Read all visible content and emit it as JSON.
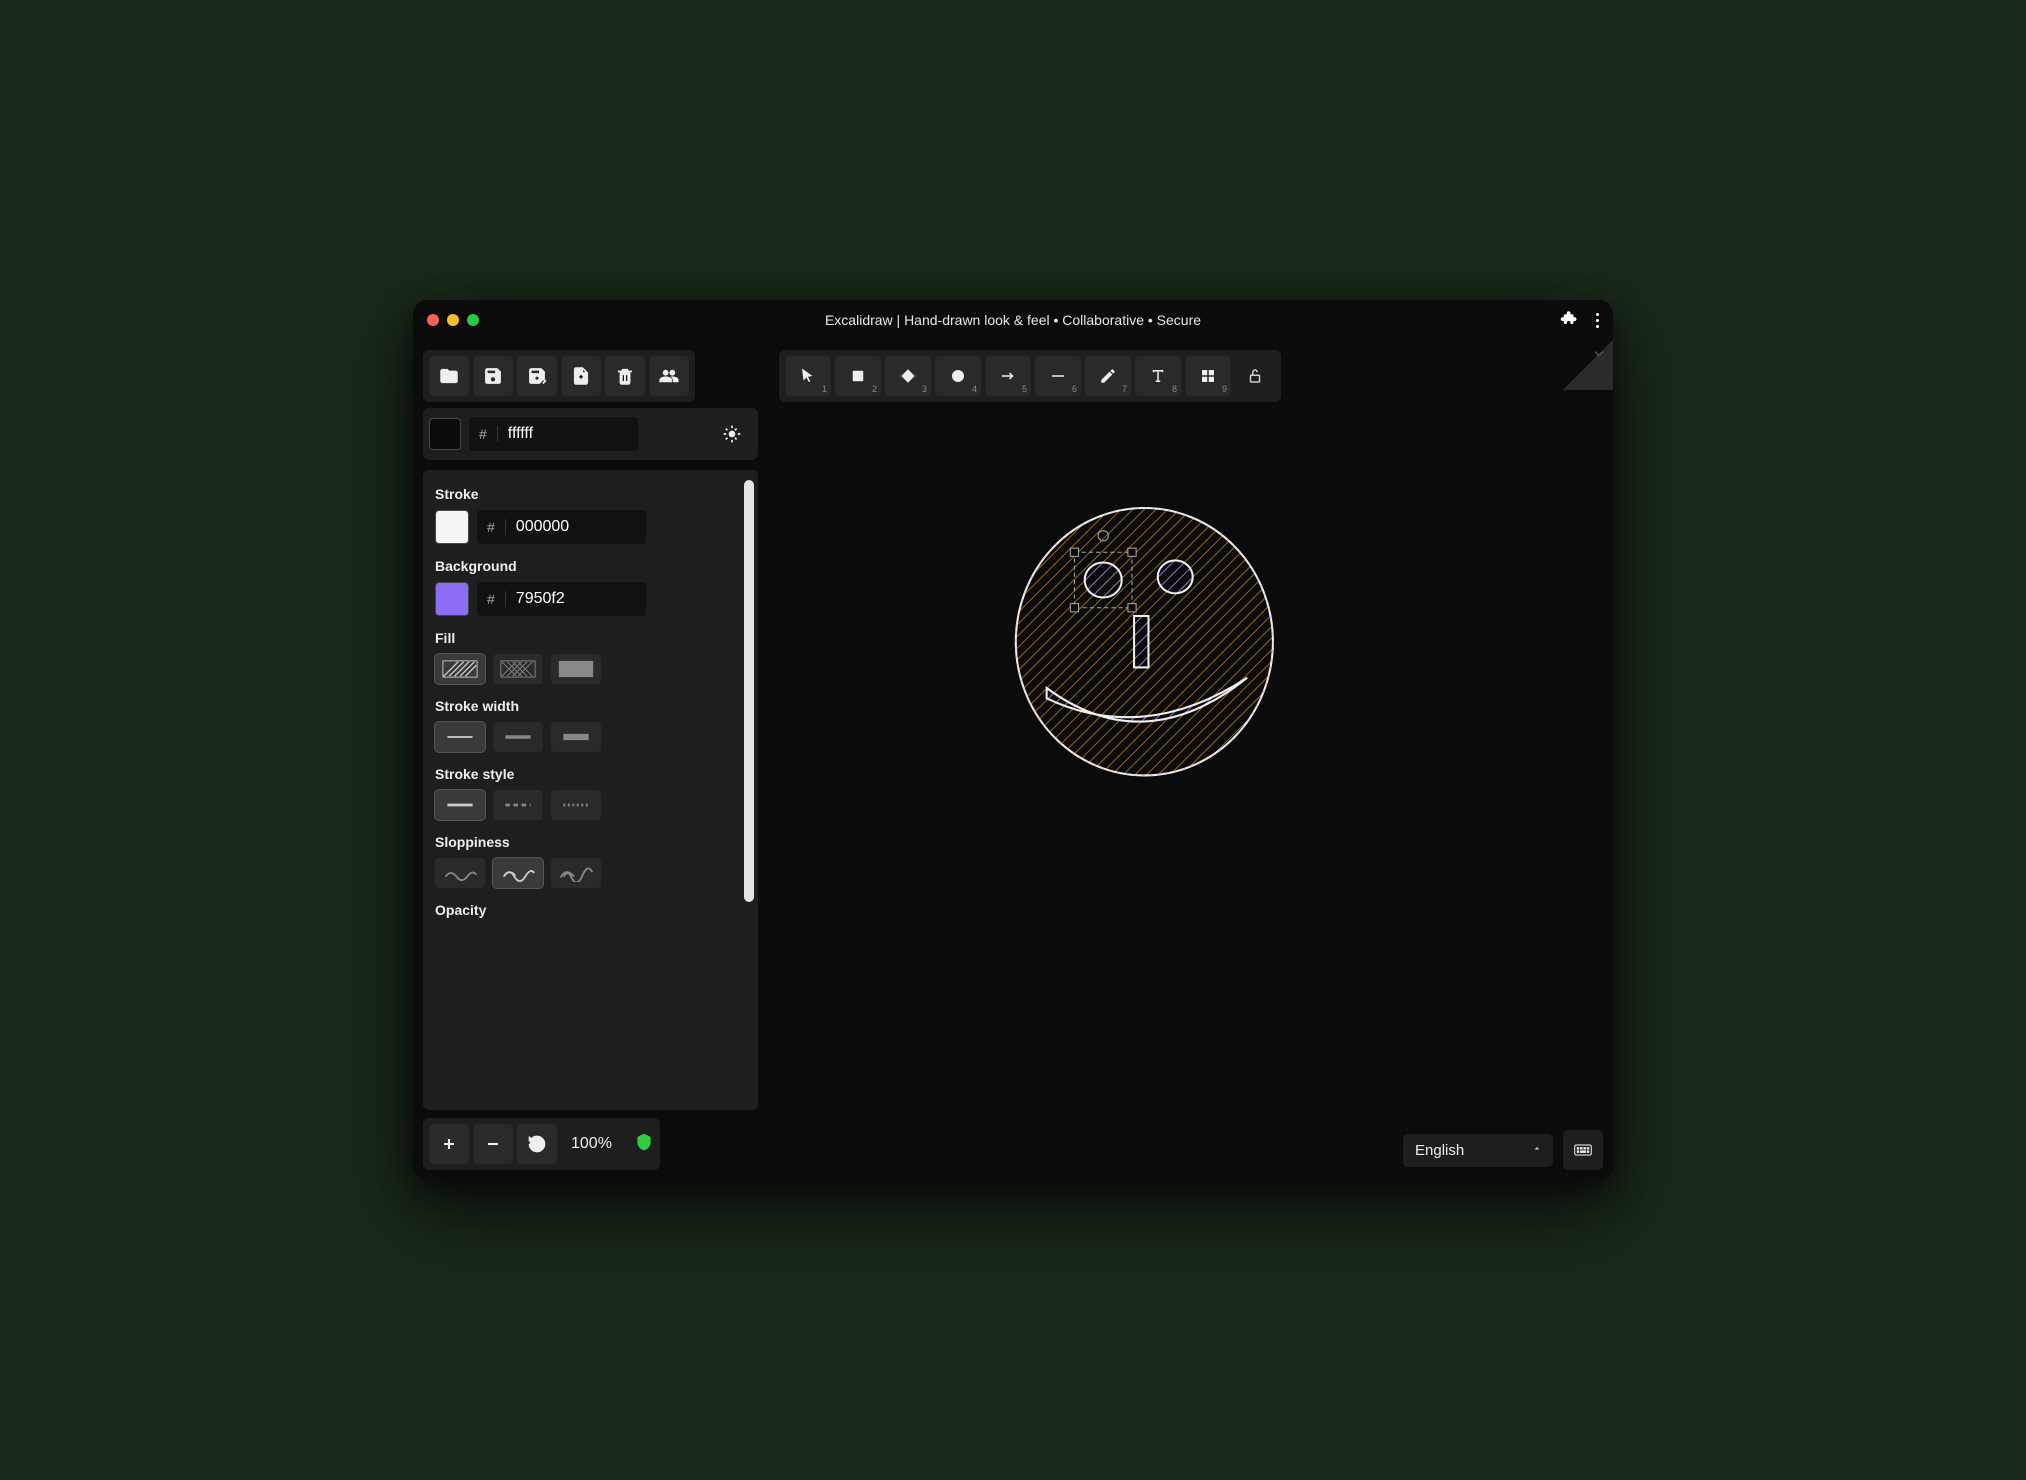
{
  "window": {
    "title": "Excalidraw | Hand-drawn look & feel • Collaborative • Secure"
  },
  "file_toolbar": [
    {
      "name": "open",
      "icon": "folder-open"
    },
    {
      "name": "save",
      "icon": "save"
    },
    {
      "name": "clear",
      "icon": "eraser"
    },
    {
      "name": "export",
      "icon": "export"
    },
    {
      "name": "delete",
      "icon": "trash"
    },
    {
      "name": "collab",
      "icon": "users"
    }
  ],
  "canvas_bg": {
    "hash": "#",
    "hex": "ffffff",
    "swatch": "#0b0b0b"
  },
  "shape_toolbar": [
    {
      "name": "select",
      "num": "1"
    },
    {
      "name": "rectangle",
      "num": "2"
    },
    {
      "name": "diamond",
      "num": "3"
    },
    {
      "name": "ellipse",
      "num": "4"
    },
    {
      "name": "arrow",
      "num": "5"
    },
    {
      "name": "line",
      "num": "6"
    },
    {
      "name": "draw",
      "num": "7"
    },
    {
      "name": "text",
      "num": "8"
    },
    {
      "name": "library",
      "num": "9"
    }
  ],
  "props": {
    "stroke": {
      "label": "Stroke",
      "hash": "#",
      "hex": "000000",
      "swatch": "#f5f5f5"
    },
    "background": {
      "label": "Background",
      "hash": "#",
      "hex": "7950f2",
      "swatch": "#8b6ef5"
    },
    "fill": {
      "label": "Fill"
    },
    "stroke_width": {
      "label": "Stroke width"
    },
    "stroke_style": {
      "label": "Stroke style"
    },
    "sloppiness": {
      "label": "Sloppiness"
    },
    "opacity": {
      "label": "Opacity"
    }
  },
  "bottom": {
    "zoom": "100%",
    "language": "English"
  }
}
